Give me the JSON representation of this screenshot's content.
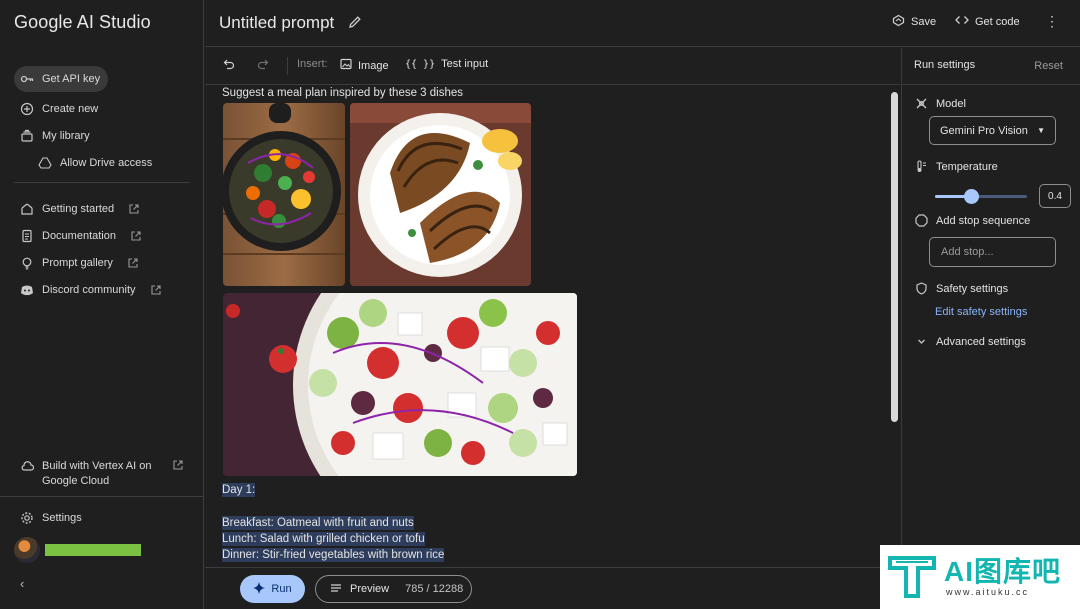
{
  "app": {
    "brand": "Google AI Studio"
  },
  "sidebar": {
    "primary": [
      {
        "label": "Get API key",
        "icon": "key-icon"
      },
      {
        "label": "Create new",
        "icon": "plus-circle-icon"
      },
      {
        "label": "My library",
        "icon": "library-icon"
      },
      {
        "label": "Allow Drive access",
        "icon": "drive-icon"
      }
    ],
    "links": [
      {
        "label": "Getting started",
        "icon": "getting-started-icon"
      },
      {
        "label": "Documentation",
        "icon": "document-icon"
      },
      {
        "label": "Prompt gallery",
        "icon": "lightbulb-icon"
      },
      {
        "label": "Discord community",
        "icon": "discord-icon"
      }
    ],
    "vertex_label": "Build with Vertex AI on Google Cloud",
    "settings_label": "Settings"
  },
  "header": {
    "title": "Untitled prompt",
    "save_label": "Save",
    "get_code_label": "Get code"
  },
  "toolbar": {
    "insert_label": "Insert:",
    "image_label": "Image",
    "test_input_label": "Test input"
  },
  "prompt": {
    "text": "Suggest a meal plan inspired by these 3 dishes",
    "images": [
      "stir-fried vegetables in pan",
      "grilled chicken breast on plate",
      "greek salad with feta and olives"
    ]
  },
  "response": {
    "day": "Day 1:",
    "lines": [
      "Breakfast: Oatmeal with fruit and nuts",
      "Lunch: Salad with grilled chicken or tofu",
      "Dinner: Stir-fried vegetables with brown rice"
    ]
  },
  "bottom": {
    "run_label": "Run",
    "preview_label": "Preview",
    "token_count": "785 / 12288"
  },
  "run_settings": {
    "title": "Run settings",
    "reset_label": "Reset",
    "model_label": "Model",
    "model_value": "Gemini Pro Vision",
    "temperature_label": "Temperature",
    "temperature_value": "0.4",
    "temperature_fraction": 0.4,
    "stop_label": "Add stop sequence",
    "stop_placeholder": "Add stop...",
    "safety_label": "Safety settings",
    "safety_link": "Edit safety settings",
    "advanced_label": "Advanced settings"
  },
  "watermark": {
    "main": "AI图库吧",
    "sub": "www.aituku.cc"
  },
  "colors": {
    "accent": "#a8c7fa",
    "link": "#8ab4f8",
    "highlight": "#2e3d5c",
    "user_bar": "#7cc242"
  }
}
